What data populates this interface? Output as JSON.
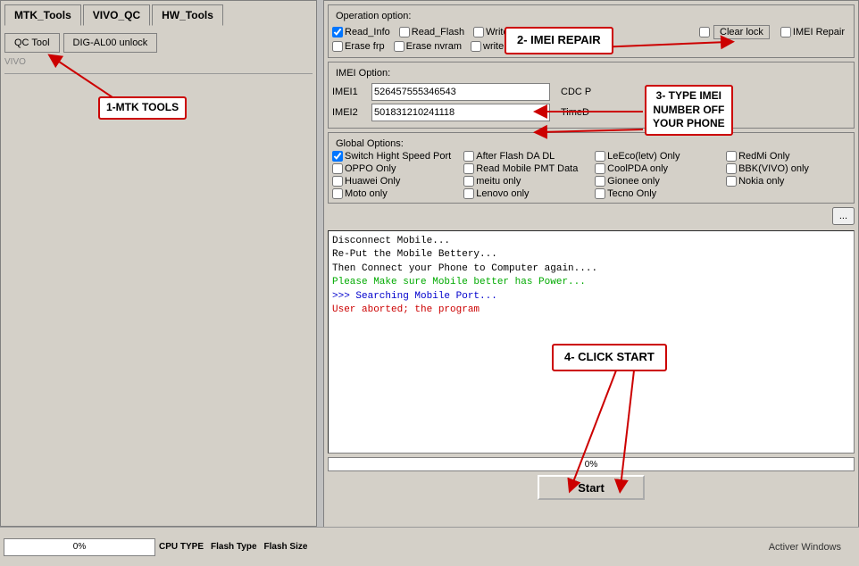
{
  "tabs": {
    "mtk": "MTK_Tools",
    "vivo": "VIVO_QC",
    "hw": "HW_Tools"
  },
  "subtabs": {
    "qc": "QC Tool",
    "dig": "DIG-AL00 unlock"
  },
  "annotation1": {
    "label": "1-MTK TOOLS"
  },
  "annotation2": {
    "label": "2- IMEI REPAIR"
  },
  "annotation3": {
    "label": "3- TYPE IMEI\nNUMBER OFF\nYOUR PHONE"
  },
  "annotation4": {
    "label": "4- CLICK START"
  },
  "operation": {
    "label": "Operation option:",
    "checkboxes": [
      {
        "id": "read_info",
        "label": "Read_Info",
        "checked": true
      },
      {
        "id": "read_flash",
        "label": "Read_Flash",
        "checked": false
      },
      {
        "id": "write_f",
        "label": "Write_F",
        "checked": false
      },
      {
        "id": "clear_lock_label",
        "label": "Clear lock",
        "checked": false
      },
      {
        "id": "imei_repair",
        "label": "IMEI Repair",
        "checked": false
      },
      {
        "id": "erase_frp",
        "label": "Erase frp",
        "checked": false
      },
      {
        "id": "erase_nvram",
        "label": "Erase nvram",
        "checked": false
      },
      {
        "id": "write_recovery",
        "label": "write recovery",
        "checked": false
      }
    ]
  },
  "imei_option": {
    "label": "IMEI Option:",
    "imei1_label": "IMEI1",
    "imei1_value": "526457555346543",
    "imei2_label": "IMEI2",
    "imei2_value": "501831210241118",
    "cdc_label": "CDC P",
    "time_label": "TimeD"
  },
  "global_options": {
    "label": "Global Options:",
    "checkboxes": [
      {
        "id": "switch_high",
        "label": "Switch Hight Speed Port",
        "checked": true
      },
      {
        "id": "after_flash",
        "label": "After Flash DA DL",
        "checked": false
      },
      {
        "id": "leeco",
        "label": "LeEco(letv) Only",
        "checked": false
      },
      {
        "id": "redmi",
        "label": "RedMi Only",
        "checked": false
      },
      {
        "id": "oppo",
        "label": "OPPO Only",
        "checked": false
      },
      {
        "id": "read_mobile",
        "label": "Read Mobile PMT Data",
        "checked": false
      },
      {
        "id": "coolpda",
        "label": "CoolPDA only",
        "checked": false
      },
      {
        "id": "bbk",
        "label": "BBK(VIVO) only",
        "checked": false
      },
      {
        "id": "huawei",
        "label": "Huawei Only",
        "checked": false
      },
      {
        "id": "meitu",
        "label": "meitu only",
        "checked": false
      },
      {
        "id": "gionee",
        "label": "Gionee only",
        "checked": false
      },
      {
        "id": "nokia",
        "label": "Nokia only",
        "checked": false
      },
      {
        "id": "moto",
        "label": "Moto only",
        "checked": false
      },
      {
        "id": "lenovo",
        "label": "Lenovo only",
        "checked": false
      },
      {
        "id": "tecno",
        "label": "Tecno Only",
        "checked": false
      }
    ]
  },
  "console": {
    "lines": [
      {
        "text": "Disconnect Mobile...",
        "color": "black"
      },
      {
        "text": "Re-Put the Mobile Bettery...",
        "color": "black"
      },
      {
        "text": "Then Connect your Phone to Computer again....",
        "color": "black"
      },
      {
        "text": "Please Make sure Mobile better has Power...",
        "color": "green"
      },
      {
        "text": ">>> Searching Mobile Port...",
        "color": "blue"
      },
      {
        "text": "User aborted; the program",
        "color": "red"
      }
    ]
  },
  "start_button": "Start",
  "progress": {
    "value": "0%"
  },
  "bottom": {
    "cpu_label": "CPU TYPE",
    "flash_label": "Flash Type",
    "flash_size_label": "Flash Size",
    "progress_label": "0%",
    "activer_text": "Activer Windows"
  },
  "browse_btn": "..."
}
